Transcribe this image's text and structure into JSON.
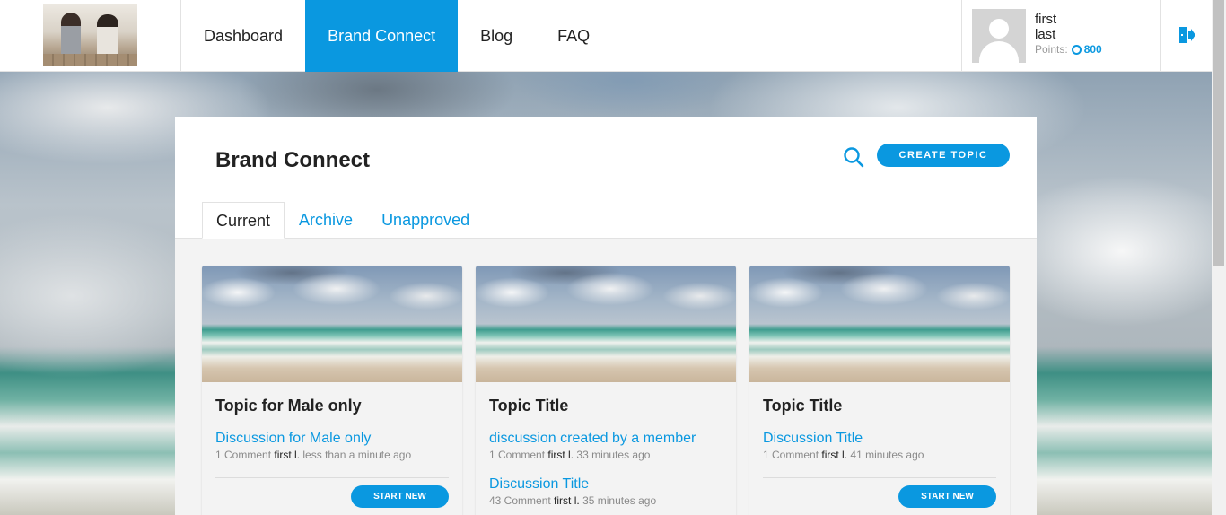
{
  "header": {
    "nav": [
      {
        "label": "Dashboard"
      },
      {
        "label": "Brand Connect"
      },
      {
        "label": "Blog"
      },
      {
        "label": "FAQ"
      }
    ],
    "active_nav": "Brand Connect",
    "user": {
      "first_name": "first",
      "last_name": "last",
      "points_label": "Points:",
      "points_value": "800"
    }
  },
  "page": {
    "title": "Brand Connect",
    "create_topic_label": "CREATE TOPIC",
    "tabs": [
      {
        "label": "Current"
      },
      {
        "label": "Archive"
      },
      {
        "label": "Unapproved"
      }
    ],
    "active_tab": "Current"
  },
  "cards": [
    {
      "title": "Topic for Male only",
      "discussions": [
        {
          "title": "Discussion for Male only",
          "comments": "1 Comment",
          "author": "first l.",
          "time": "less than a minute ago"
        }
      ],
      "start_label": "START NEW"
    },
    {
      "title": "Topic Title",
      "discussions": [
        {
          "title": "discussion created by a member",
          "comments": "1 Comment",
          "author": "first l.",
          "time": "33 minutes ago"
        },
        {
          "title": "Discussion Title",
          "comments": "43 Comment",
          "author": "first l.",
          "time": "35 minutes ago"
        }
      ]
    },
    {
      "title": "Topic Title",
      "discussions": [
        {
          "title": "Discussion Title",
          "comments": "1 Comment",
          "author": "first l.",
          "time": "41 minutes ago"
        }
      ],
      "start_label": "START NEW"
    }
  ],
  "colors": {
    "accent": "#0a98e0",
    "text": "#222222",
    "muted": "#8a8a8a"
  },
  "icons": {
    "search": "search-icon",
    "logout": "logout-icon",
    "points": "coin-icon",
    "avatar": "user-avatar-icon"
  }
}
